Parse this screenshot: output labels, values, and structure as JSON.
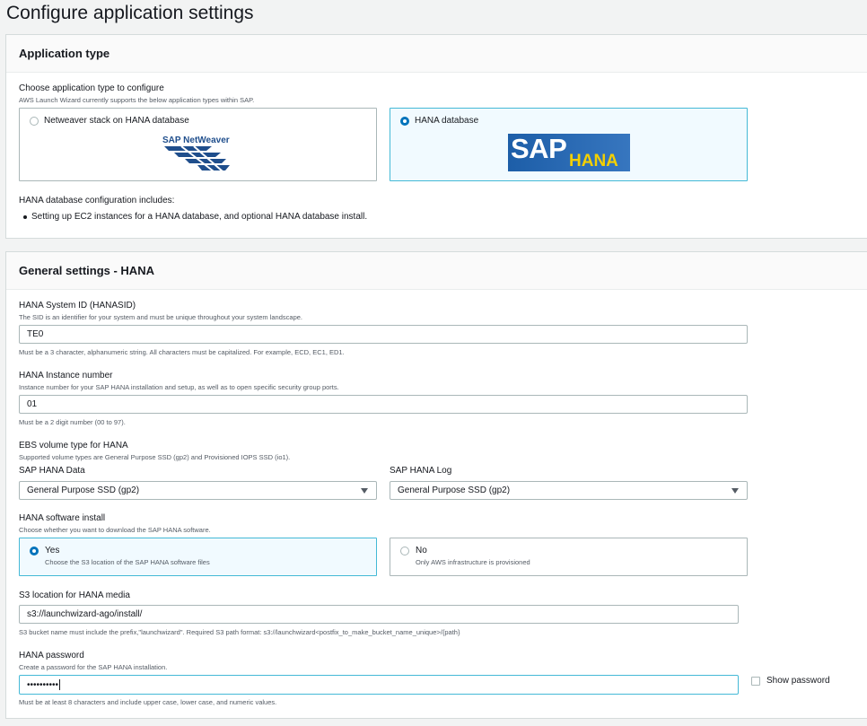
{
  "page": {
    "title": "Configure application settings"
  },
  "application_type": {
    "header": "Application type",
    "choose_label": "Choose application type to configure",
    "choose_desc": "AWS Launch Wizard currently supports the below application types within SAP.",
    "options": [
      {
        "label": "Netweaver stack on HANA database",
        "logo_text": "SAP NetWeaver",
        "selected": false
      },
      {
        "label": "HANA database",
        "logo_text_1": "SAP",
        "logo_text_2": "HANA",
        "selected": true
      }
    ],
    "includes_label": "HANA database configuration includes:",
    "includes_items": [
      "Setting up EC2 instances for a HANA database, and optional HANA database install."
    ]
  },
  "general": {
    "header": "General settings - HANA",
    "sid": {
      "label": "HANA System ID (HANASID)",
      "desc": "The SID is an identifier for your system and must be unique throughout your system landscape.",
      "value": "TE0",
      "hint": "Must be a 3 character, alphanumeric string. All characters must be capitalized. For example, ECD, EC1, ED1."
    },
    "instance": {
      "label": "HANA Instance number",
      "desc": "Instance number for your SAP HANA installation and setup, as well as to open specific security group ports.",
      "value": "01",
      "hint": "Must be a 2 digit number (00 to 97)."
    },
    "ebs": {
      "label": "EBS volume type for HANA",
      "desc": "Supported volume types are General Purpose SSD (gp2) and Provisioned IOPS SSD (io1).",
      "data_label": "SAP HANA Data",
      "data_value": "General Purpose SSD (gp2)",
      "log_label": "SAP HANA Log",
      "log_value": "General Purpose SSD (gp2)"
    },
    "software": {
      "label": "HANA software install",
      "desc": "Choose whether you want to download the SAP HANA software.",
      "yes_label": "Yes",
      "yes_desc": "Choose the S3 location of the SAP HANA software files",
      "no_label": "No",
      "no_desc": "Only AWS infrastructure is provisioned",
      "selected": "Yes"
    },
    "s3": {
      "label": "S3 location for HANA media",
      "value": "s3://launchwizard-ago/install/",
      "hint": "S3 bucket name must include the prefix,\"launchwizard\". Required S3 path format: s3://launchwizard<postfix_to_make_bucket_name_unique>/{path}"
    },
    "password": {
      "label": "HANA password",
      "desc": "Create a password for the SAP HANA installation.",
      "value": "••••••••••",
      "show_label": "Show password",
      "hint": "Must be at least 8 characters and include upper case, lower case, and numeric values."
    }
  },
  "colors": {
    "accent": "#0073bb",
    "selected_border": "#44b9d6",
    "selected_bg": "#f1faff",
    "sap_blue": "#1f5fa8",
    "hana_yellow": "#f4d000"
  }
}
